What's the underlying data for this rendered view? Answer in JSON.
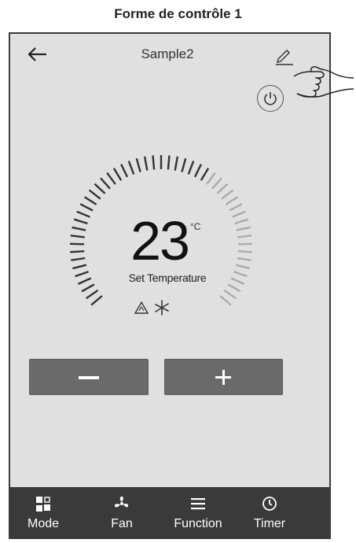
{
  "caption": "Forme de contrôle 1",
  "header": {
    "title": "Sample2",
    "back_icon": "back-arrow-icon",
    "edit_icon": "pencil-icon"
  },
  "power": {
    "icon": "power-icon"
  },
  "temperature": {
    "value": "23",
    "unit": "°C",
    "label": "Set Temperature"
  },
  "mode_icons": [
    "auto-mode-icon",
    "fan-speed-icon"
  ],
  "controls": {
    "decrease_icon": "minus-icon",
    "increase_icon": "plus-icon"
  },
  "bottom_nav": [
    {
      "label": "Mode",
      "icon": "mode-icon"
    },
    {
      "label": "Fan",
      "icon": "fan-icon"
    },
    {
      "label": "Function",
      "icon": "menu-icon"
    },
    {
      "label": "Timer",
      "icon": "clock-icon"
    }
  ],
  "colors": {
    "panel": "#e0e0e0",
    "button": "#6a6a6a",
    "nav_bar": "#3a3a3a",
    "tick_dark": "#333333",
    "tick_light": "#aaaaaa"
  }
}
